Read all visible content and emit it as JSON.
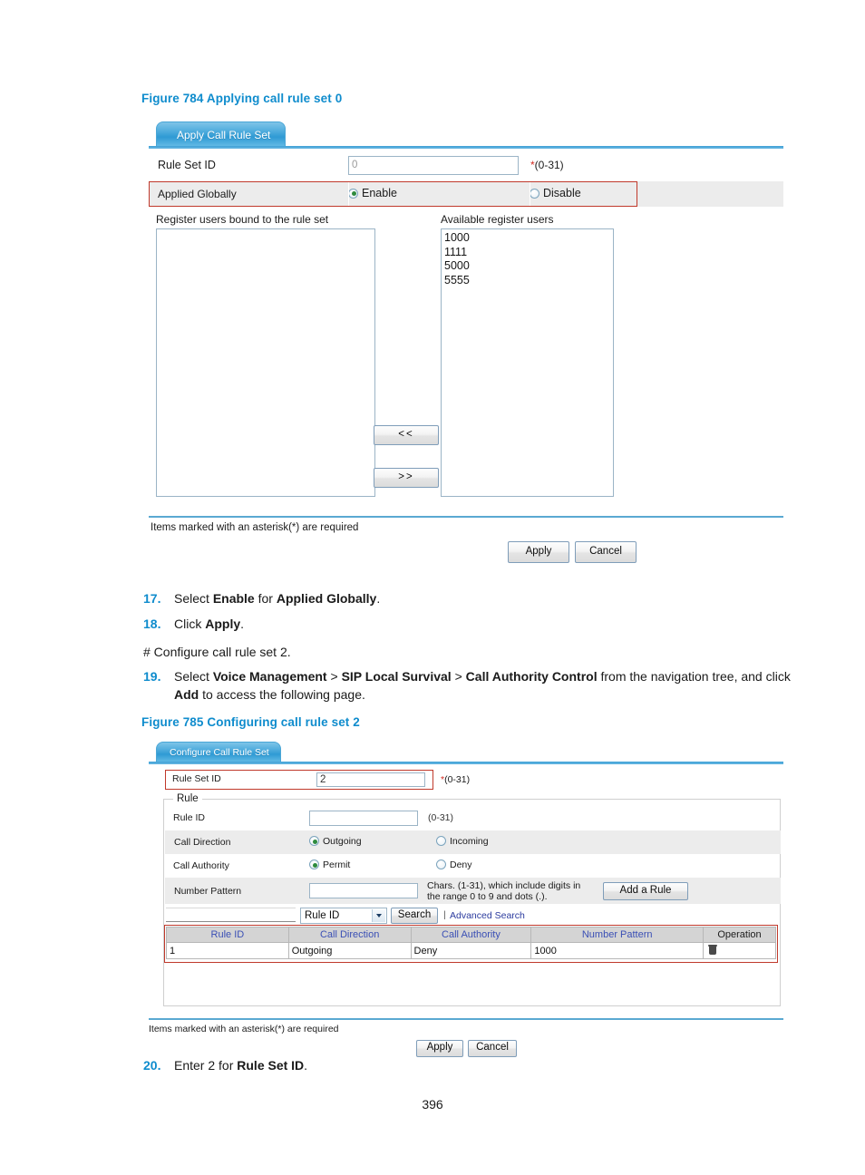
{
  "page": {
    "number": "396"
  },
  "figure784": {
    "caption": "Figure 784 Applying call rule set 0",
    "tab_label": "Apply Call Rule Set",
    "rule_set_id": {
      "label": "Rule Set ID",
      "value": "0",
      "hint": "(0-31)",
      "star": "*"
    },
    "applied_globally": {
      "label": "Applied Globally",
      "enable_label": "Enable",
      "disable_label": "Disable",
      "selected": "Enable"
    },
    "bound_list": {
      "label": "Register users bound to the rule set",
      "items": []
    },
    "available_list": {
      "label": "Available register users",
      "items": [
        "1000",
        "1111",
        "5000",
        "5555"
      ]
    },
    "move_left_label": "<<",
    "move_right_label": ">>",
    "required_note": "Items marked with an asterisk(*) are required",
    "apply_label": "Apply",
    "cancel_label": "Cancel"
  },
  "steps_mid": {
    "s17": {
      "num": "17.",
      "before": "Select ",
      "b1": "Enable",
      "mid": " for ",
      "b2": "Applied Globally",
      "after": "."
    },
    "s18": {
      "num": "18.",
      "before": "Click ",
      "b1": "Apply",
      "after": "."
    },
    "comment": "# Configure call rule set 2.",
    "s19": {
      "num": "19.",
      "before": "Select ",
      "b1": "Voice Management",
      "sep1": " > ",
      "b2": "SIP Local Survival",
      "sep2": " > ",
      "b3": "Call Authority Control",
      "after": " from the navigation tree, and click ",
      "b4": "Add",
      "tail": " to access the following page."
    }
  },
  "figure785": {
    "caption": "Figure 785 Configuring call rule set 2",
    "tab_label": "Configure Call Rule Set",
    "rule_set_id": {
      "label": "Rule Set ID",
      "value": "2",
      "hint": "(0-31)",
      "star": "*"
    },
    "rule_legend": "Rule",
    "rule_id": {
      "label": "Rule ID",
      "value": "",
      "hint": "(0-31)"
    },
    "call_direction": {
      "label": "Call Direction",
      "outgoing_label": "Outgoing",
      "incoming_label": "Incoming",
      "selected": "Outgoing"
    },
    "call_authority": {
      "label": "Call Authority",
      "permit_label": "Permit",
      "deny_label": "Deny",
      "selected": "Permit"
    },
    "number_pattern": {
      "label": "Number Pattern",
      "value": "",
      "hint_line1": "Chars. (1-31), which include digits in",
      "hint_line2": "the range 0 to 9 and dots (.)."
    },
    "add_rule_label": "Add a Rule",
    "search": {
      "input_value": "",
      "select_value": "Rule ID",
      "button_label": "Search",
      "advanced_label": "Advanced Search"
    },
    "table": {
      "columns": [
        "Rule ID",
        "Call Direction",
        "Call Authority",
        "Number Pattern",
        "Operation"
      ],
      "rows": [
        {
          "rule_id": "1",
          "call_direction": "Outgoing",
          "call_authority": "Deny",
          "number_pattern": "1000",
          "operation_icon": "trash-icon"
        }
      ]
    },
    "required_note": "Items marked with an asterisk(*) are required",
    "apply_label": "Apply",
    "cancel_label": "Cancel"
  },
  "steps_end": {
    "s20": {
      "num": "20.",
      "before": "Enter 2 for ",
      "b1": "Rule Set ID",
      "after": "."
    }
  }
}
